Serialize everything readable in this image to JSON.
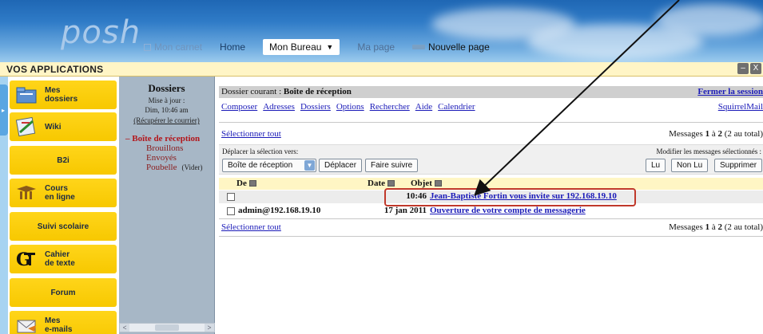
{
  "header": {
    "logo": "posh",
    "nav": {
      "carnet": "Mon carnet",
      "home": "Home",
      "bureau": "Mon Bureau",
      "mapage": "Ma page",
      "nouvelle": "Nouvelle page"
    }
  },
  "apps_bar": {
    "title": "VOS APPLICATIONS",
    "min": "–",
    "close": "X"
  },
  "apps": [
    {
      "label": "Mes\ndossiers",
      "icon": "folder-icon"
    },
    {
      "label": "Wiki",
      "icon": "wiki-icon"
    },
    {
      "label": "B2i",
      "icon": ""
    },
    {
      "label": "Cours\nen ligne",
      "icon": "graduation-icon"
    },
    {
      "label": "Suivi scolaire",
      "icon": ""
    },
    {
      "label": "Cahier\nde texte",
      "icon": "cahier-icon"
    },
    {
      "label": "Forum",
      "icon": ""
    },
    {
      "label": "Mes\ne-mails",
      "icon": "mail-icon"
    }
  ],
  "dossiers": {
    "title": "Dossiers",
    "maj1": "Mise à jour :",
    "maj2": "Dim, 10:46 am",
    "recup": "(Récupérer le courrier)",
    "current": "Boîte de réception",
    "folders": [
      "Brouillons",
      "Envoyés",
      "Poubelle"
    ],
    "vider": "(Vider)"
  },
  "main": {
    "current_prefix": "Dossier courant : ",
    "current_folder": "Boîte de réception",
    "logout": "Fermer la session",
    "menu": [
      "Composer",
      "Adresses",
      "Dossiers",
      "Options",
      "Rechercher",
      "Aide",
      "Calendrier"
    ],
    "squirrelmail": "SquirrelMail",
    "select_all": "Sélectionner tout",
    "messages_prefix": "Messages ",
    "messages_range": "1",
    "messages_to": " à ",
    "messages_end": "2",
    "messages_total": " (2 au total)",
    "move_label": "Déplacer la sélection vers:",
    "modify_label": "Modifier les messages sélectionnés :",
    "move_select": "Boîte de réception",
    "btn_move": "Déplacer",
    "btn_forward": "Faire suivre",
    "btn_read": "Lu",
    "btn_unread": "Non Lu",
    "btn_delete": "Supprimer",
    "columns": {
      "from": "De",
      "date": "Date",
      "subject": "Objet"
    },
    "rows": [
      {
        "from": "",
        "date": "10:46",
        "subject": "Jean-Baptiste Fortin vous invite sur 192.168.19.10"
      },
      {
        "from": "admin@192.168.19.10",
        "date": "17 jan 2011",
        "subject": "Ouverture de votre compte de messagerie"
      }
    ]
  }
}
